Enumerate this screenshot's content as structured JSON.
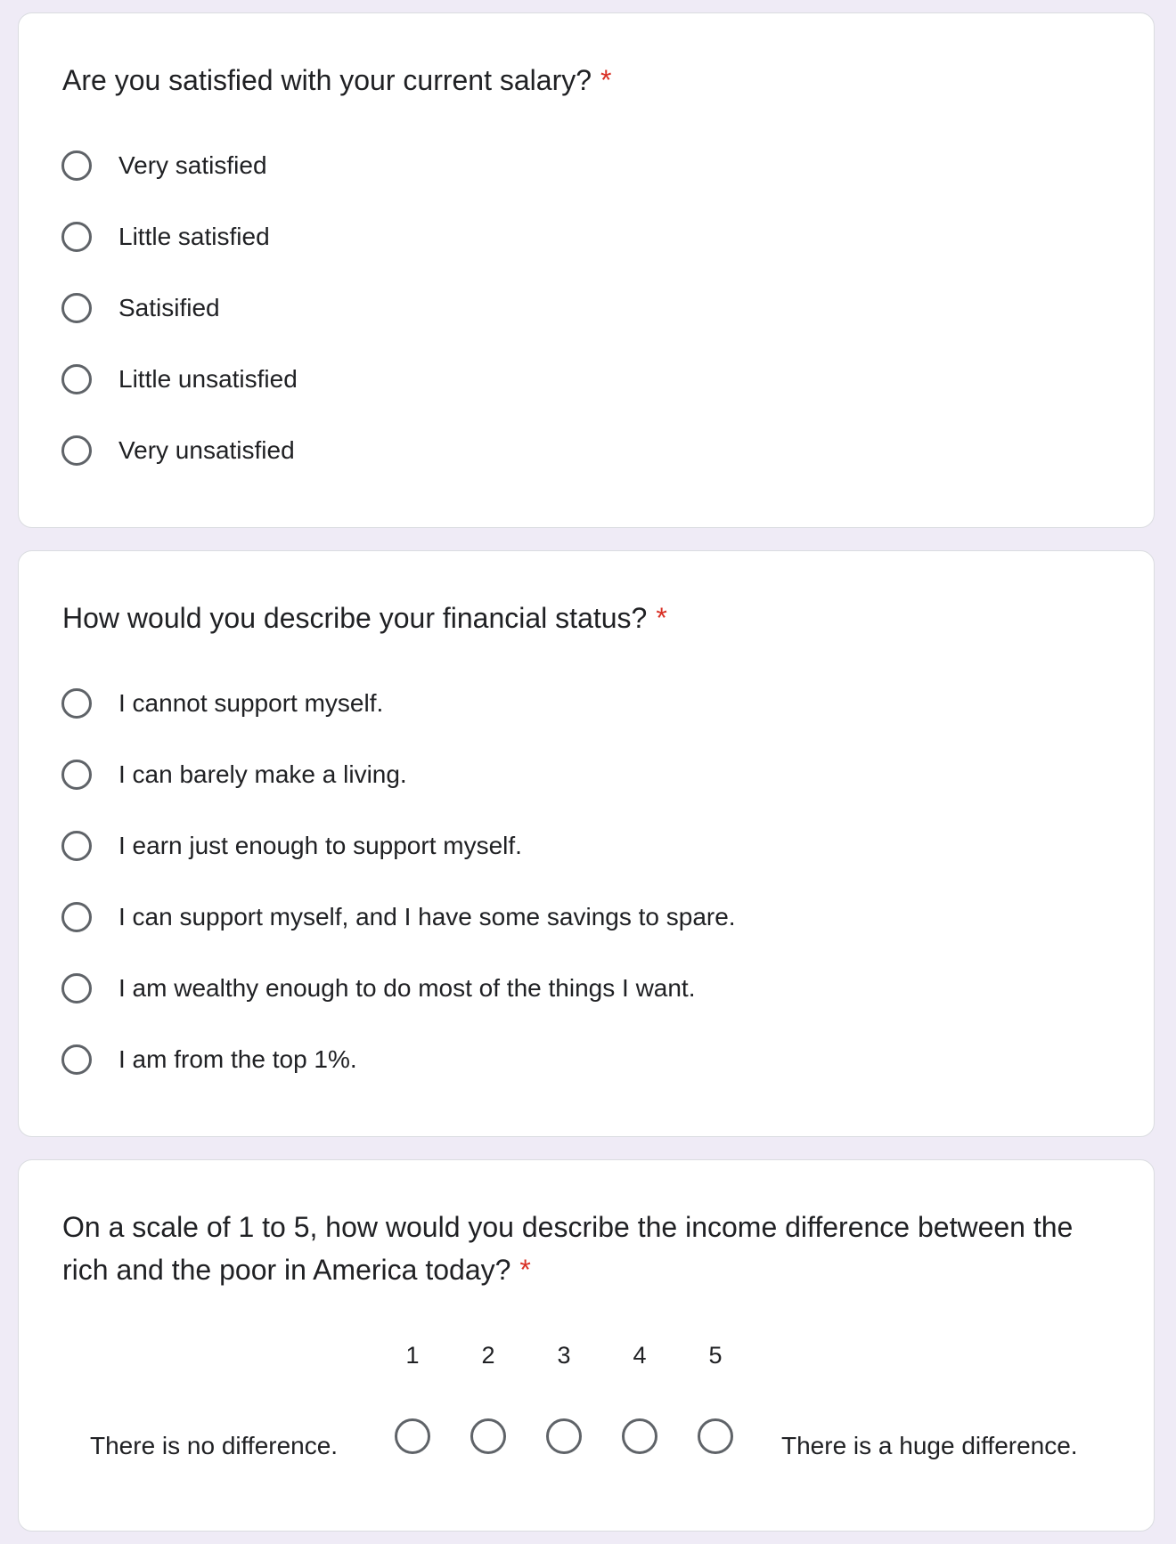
{
  "colors": {
    "page_background": "#efebf6",
    "card_background": "#ffffff",
    "required_asterisk": "#d93025",
    "radio_border": "#5f6368"
  },
  "q1": {
    "question": "Are you satisfied with your current salary?",
    "required_mark": "*",
    "options": [
      "Very satisfied",
      "Little satisfied",
      "Satisified",
      "Little unsatisfied",
      "Very unsatisfied"
    ]
  },
  "q2": {
    "question": "How would you describe your financial status?",
    "required_mark": "*",
    "options": [
      "I cannot support myself.",
      "I can barely make a living.",
      "I earn just enough to support myself.",
      "I can support myself, and I have some savings to spare.",
      "I am wealthy enough to do most of the things I want.",
      "I am from the top 1%."
    ]
  },
  "q3": {
    "question": "On a scale of 1 to 5, how would you describe the income difference between the rich and the poor in America today?",
    "required_mark": "*",
    "scale_numbers": [
      "1",
      "2",
      "3",
      "4",
      "5"
    ],
    "low_label": "There is no difference.",
    "high_label": "There is a huge difference."
  }
}
